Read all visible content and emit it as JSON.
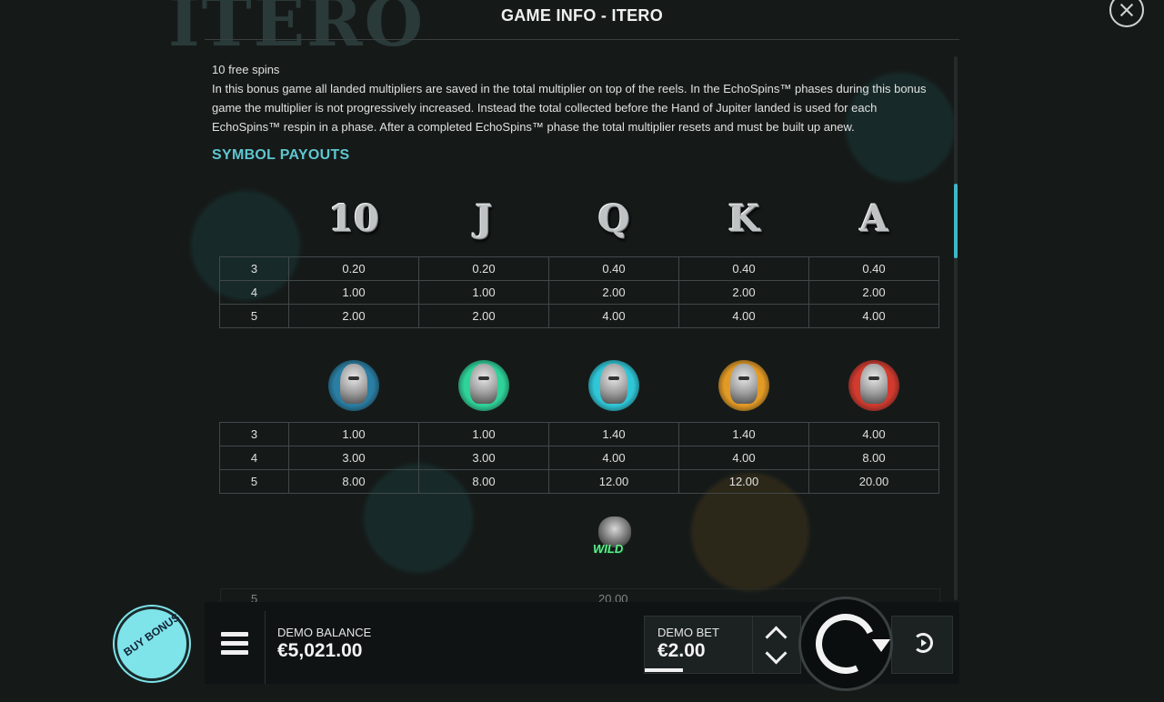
{
  "header": {
    "title": "GAME INFO - ITERO",
    "bg_logo": "ITERO"
  },
  "rules": {
    "heading": "10 free spins",
    "body": "In this bonus game all landed multipliers are saved in the total multiplier on top of the reels. In the EchoSpins™ phases during this bonus game the multiplier is not progressively increased. Instead the total collected before the Hand of Jupiter landed is used for each EchoSpins™ respin in a phase. After a completed EchoSpins™ phase the total multiplier resets and must be built up anew."
  },
  "payouts": {
    "title": "SYMBOL PAYOUTS",
    "low_symbols": [
      "10",
      "J",
      "Q",
      "K",
      "A"
    ],
    "low_rows": [
      {
        "count": "3",
        "values": [
          "0.20",
          "0.20",
          "0.40",
          "0.40",
          "0.40"
        ]
      },
      {
        "count": "4",
        "values": [
          "1.00",
          "1.00",
          "2.00",
          "2.00",
          "2.00"
        ]
      },
      {
        "count": "5",
        "values": [
          "2.00",
          "2.00",
          "4.00",
          "4.00",
          "4.00"
        ]
      }
    ],
    "high_symbols": [
      {
        "icon": "female-bust-blue-icon",
        "color": "#2a7ea3"
      },
      {
        "icon": "male-bust-green-icon",
        "color": "#2fd39a"
      },
      {
        "icon": "bearded-bust-cyan-icon",
        "color": "#2fc7d8"
      },
      {
        "icon": "bearded-bust-orange-icon",
        "color": "#e39a25"
      },
      {
        "icon": "zeus-bust-red-icon",
        "color": "#d23a2e"
      }
    ],
    "high_rows": [
      {
        "count": "3",
        "values": [
          "1.00",
          "1.00",
          "1.40",
          "1.40",
          "4.00"
        ]
      },
      {
        "count": "4",
        "values": [
          "3.00",
          "3.00",
          "4.00",
          "4.00",
          "8.00"
        ]
      },
      {
        "count": "5",
        "values": [
          "8.00",
          "8.00",
          "12.00",
          "12.00",
          "20.00"
        ]
      }
    ],
    "wild": {
      "label": "WILD",
      "row_count": "5",
      "row_value": "20.00"
    }
  },
  "bottom_bar": {
    "buy_bonus": "BUY BONUS",
    "balance_label": "DEMO BALANCE",
    "balance_value": "€5,021.00",
    "bet_label": "DEMO BET",
    "bet_value": "€2.00"
  }
}
